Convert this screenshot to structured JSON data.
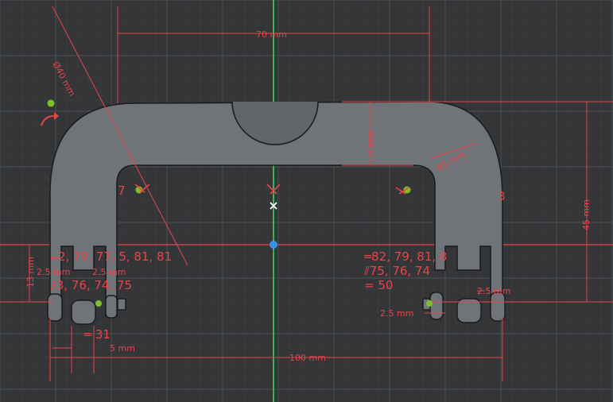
{
  "app": {
    "view": "Sketch"
  },
  "colors": {
    "background": "#333537",
    "grid_minor": "#3d3f42",
    "grid_major": "#4a4d50",
    "body_fill": "#707478",
    "body_stroke": "#1b1c1e",
    "dimension": "#e8444a",
    "constraint_point": "#7fbf2a",
    "axis_vertical": "#3ee05a",
    "origin": "#3a8fe6"
  },
  "dimensions": {
    "top_width": "70 mm",
    "diameter": "Ø40 mm",
    "inner_depth": "4 mm",
    "inner_radius": "R5 mm",
    "height": "45 mm",
    "left_height": "13 mm",
    "left_slot_a": "2.5 mm",
    "left_slot_b": "2.5 mm",
    "left_bottom_gap": "5 mm",
    "overall_width": "100 mm",
    "right_slot": "2.5 mm",
    "right_small": "2.5 mm"
  },
  "constraints": {
    "left_parallel_1": "═2, 79, 77, 5, 81, 81",
    "left_parallel_2": "⫽3, 76, 74, 75",
    "left_equal": "═ 31",
    "right_parallel_1": "═82, 79, 81, 8",
    "right_parallel_2": "⫽75, 76, 74",
    "right_equal": "= 50",
    "left_marker": "7",
    "right_marker": "3"
  },
  "icons": {
    "rotate": "rotate-arrow-icon",
    "cursor": "crosshair-cursor-icon"
  }
}
